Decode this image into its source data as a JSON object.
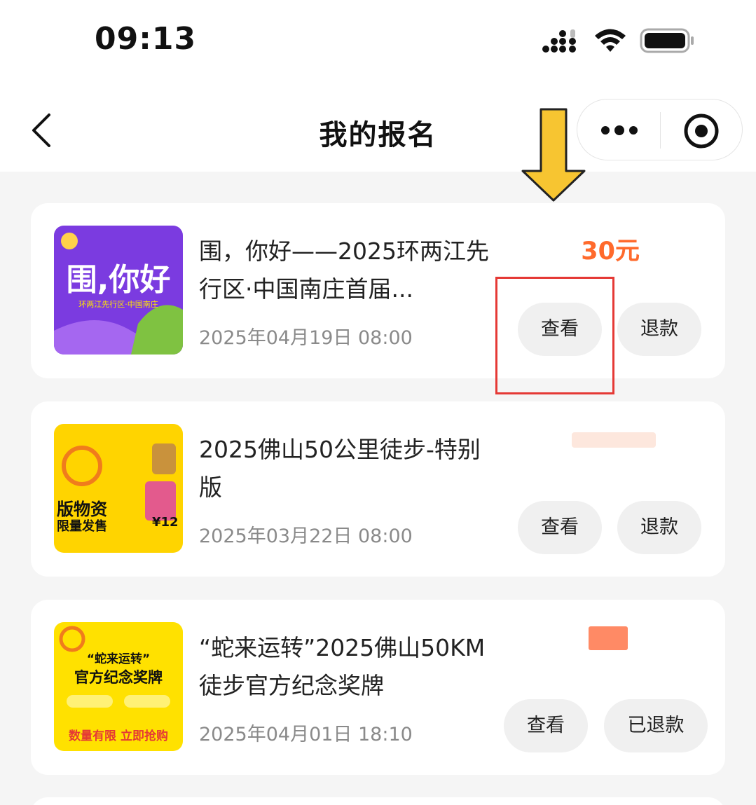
{
  "status_bar": {
    "time": "09:13"
  },
  "nav": {
    "title": "我的报名"
  },
  "registrations": [
    {
      "title": "围，你好——2025环两江先行区·中国南庄首届...",
      "date": "2025年04月19日 08:00",
      "price": "30元",
      "view_label": "查看",
      "action_label": "退款",
      "thumb": {
        "bg": "#7b3be0",
        "caption": "围,你好",
        "sub": "环两江先行区·中国南庄"
      }
    },
    {
      "title": "2025佛山50公里徒步-特别版",
      "date": "2025年03月22日 08:00",
      "view_label": "查看",
      "action_label": "退款",
      "thumb": {
        "bg": "#ffd400",
        "caption": "版物资",
        "sub": "限量发售",
        "price": "¥12"
      }
    },
    {
      "title": "“蛇来运转”2025佛山50KM徒步官方纪念奖牌",
      "date": "2025年04月01日 18:10",
      "view_label": "查看",
      "action_label": "已退款",
      "thumb": {
        "bg": "#ffe100",
        "caption": "“蛇来运转”",
        "sub": "官方纪念奖牌",
        "footer": "数量有限 立即抢购"
      }
    }
  ],
  "colors": {
    "price": "#ff6a2c",
    "highlight": "#e53935",
    "arrow": "#f7c531"
  }
}
